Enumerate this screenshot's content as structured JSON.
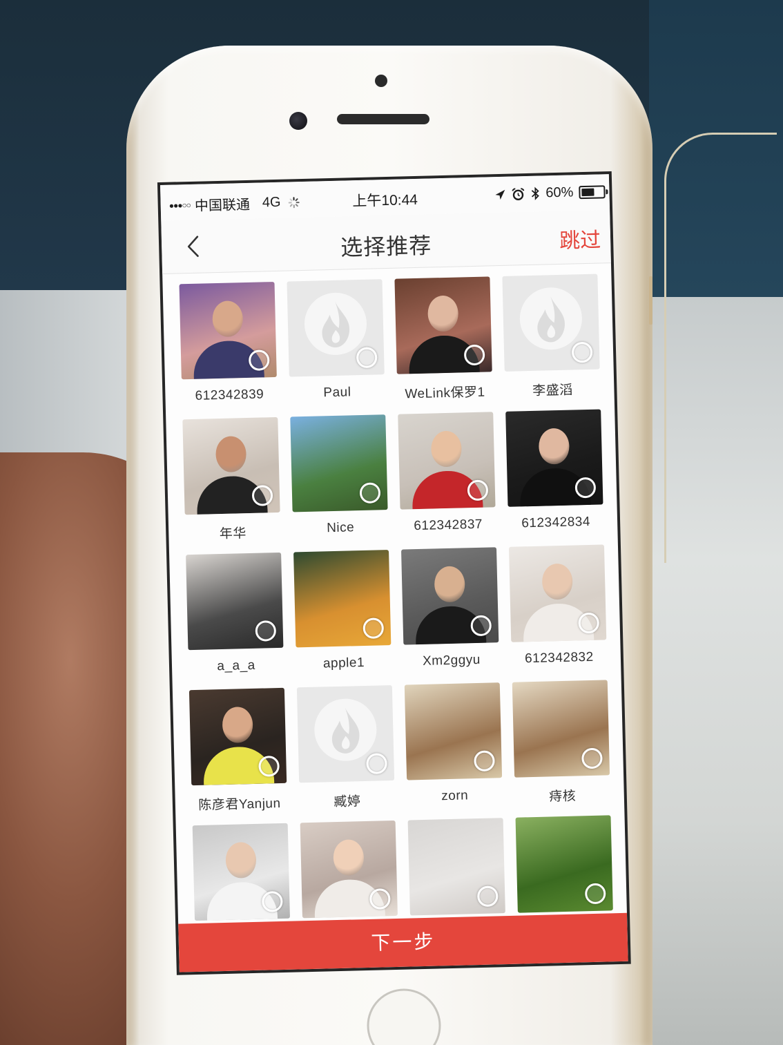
{
  "status_bar": {
    "signal": "●●●○○",
    "carrier": "中国联通",
    "network": "4G",
    "time": "上午10:44",
    "battery": "60%"
  },
  "nav": {
    "title": "选择推荐",
    "skip": "跳过"
  },
  "users": [
    {
      "name": "612342839",
      "avatar": {
        "kind": "photo",
        "colors": [
          "#7b5a9e",
          "#d49c9c",
          "#b08a6c"
        ],
        "skin": "#d8a88a",
        "clothes": "#3a3a6a"
      }
    },
    {
      "name": "Paul",
      "avatar": {
        "kind": "default"
      }
    },
    {
      "name": "WeLink保罗1",
      "avatar": {
        "kind": "photo",
        "colors": [
          "#6a4030",
          "#a86a5a",
          "#3a2a2a"
        ],
        "skin": "#e0b8a0",
        "clothes": "#1a1a1a"
      }
    },
    {
      "name": "李盛滔",
      "avatar": {
        "kind": "default"
      }
    },
    {
      "name": "年华",
      "avatar": {
        "kind": "photo",
        "colors": [
          "#e8e2dc",
          "#c8beb4",
          "#d0c4b8"
        ],
        "skin": "#c89070",
        "clothes": "#222222"
      }
    },
    {
      "name": "Nice",
      "avatar": {
        "kind": "photo",
        "colors": [
          "#7ab0e0",
          "#4a8040",
          "#3a5a2a"
        ]
      }
    },
    {
      "name": "612342837",
      "avatar": {
        "kind": "photo",
        "colors": [
          "#d8d4ce",
          "#c8c0b8",
          "#b0a898"
        ],
        "skin": "#e8c0a0",
        "clothes": "#c4262a"
      }
    },
    {
      "name": "612342834",
      "avatar": {
        "kind": "photo",
        "colors": [
          "#2a2a2a",
          "#1a1a1a",
          "#141414"
        ],
        "skin": "#e0b8a0",
        "clothes": "#101010"
      }
    },
    {
      "name": "a_a_a",
      "avatar": {
        "kind": "photo",
        "colors": [
          "#d8d4d0",
          "#4a4a4a",
          "#2a2a2a"
        ]
      }
    },
    {
      "name": "apple1",
      "avatar": {
        "kind": "photo",
        "colors": [
          "#2e4a30",
          "#d89030",
          "#e8a838"
        ]
      }
    },
    {
      "name": "Xm2ggyu",
      "avatar": {
        "kind": "photo",
        "colors": [
          "#7a7a7a",
          "#5a5a5a",
          "#4a4a4a"
        ],
        "skin": "#d8b090",
        "clothes": "#1a1a1a"
      }
    },
    {
      "name": "612342832",
      "avatar": {
        "kind": "photo",
        "colors": [
          "#ece8e4",
          "#d8d0c8",
          "#e0d8d0"
        ],
        "skin": "#e8c8b0",
        "clothes": "#f0ece8"
      }
    },
    {
      "name": "陈彦君Yanjun",
      "avatar": {
        "kind": "photo",
        "colors": [
          "#4a3a30",
          "#2a2420",
          "#3a2a22"
        ],
        "skin": "#d8a888",
        "clothes": "#e8e24a"
      }
    },
    {
      "name": "臧婷",
      "avatar": {
        "kind": "default"
      }
    },
    {
      "name": "zorn",
      "avatar": {
        "kind": "photo",
        "colors": [
          "#e0d4bc",
          "#9a7450",
          "#d8c8a8"
        ]
      }
    },
    {
      "name": "痔核",
      "avatar": {
        "kind": "photo",
        "colors": [
          "#e4d8c2",
          "#9a7450",
          "#d8c8a8"
        ]
      }
    },
    {
      "avatar": {
        "kind": "photo",
        "colors": [
          "#c8c8c8",
          "#e8e8e8",
          "#b0b0b0"
        ],
        "skin": "#e8c8b0",
        "clothes": "#f4f4f4"
      }
    },
    {
      "avatar": {
        "kind": "photo",
        "colors": [
          "#d8ccc4",
          "#b8a8a0",
          "#e8e0d8"
        ],
        "skin": "#f0d0b8",
        "clothes": "#f0ece8"
      }
    },
    {
      "avatar": {
        "kind": "photo",
        "colors": [
          "#d8d6d4",
          "#e8e6e4",
          "#cfcac6"
        ]
      }
    },
    {
      "avatar": {
        "kind": "photo",
        "colors": [
          "#8ab060",
          "#3a6a20",
          "#5a8a30"
        ]
      }
    }
  ],
  "footer": {
    "next": "下一步"
  },
  "colors": {
    "accent": "#e4463c",
    "default_avatar": "#e8e8e8",
    "default_logo": "#dcdcdc"
  }
}
